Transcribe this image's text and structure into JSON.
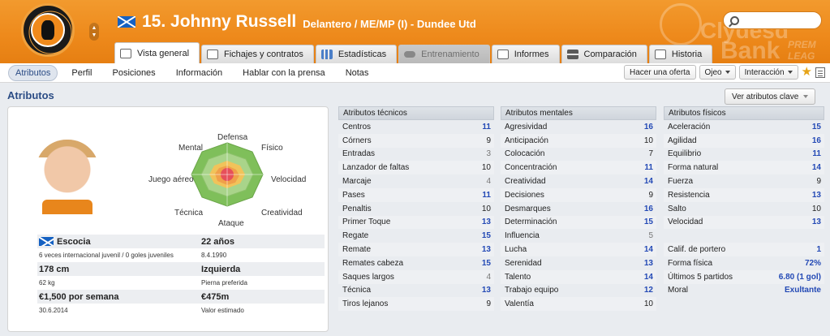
{
  "header": {
    "player_name": "15. Johnny Russell",
    "subtitle": "Delantero / ME/MP (I) - Dundee Utd",
    "flag_icon": "scotland-flag-icon",
    "stepper_up": "▲",
    "stepper_down": "▼",
    "sponsor": {
      "line1": "Clydesd",
      "line2": "Bank",
      "line3": "PREM LEAG"
    },
    "search_placeholder": ""
  },
  "tabs": [
    {
      "label": "Vista general",
      "icon": "overview-icon",
      "state": "active"
    },
    {
      "label": "Fichajes y contratos",
      "icon": "document-icon",
      "state": "normal"
    },
    {
      "label": "Estadísticas",
      "icon": "bar-chart-icon",
      "state": "normal"
    },
    {
      "label": "Entrenamiento",
      "icon": "cloud-icon",
      "state": "disabled"
    },
    {
      "label": "Informes",
      "icon": "report-icon",
      "state": "normal"
    },
    {
      "label": "Comparación",
      "icon": "compare-icon",
      "state": "normal"
    },
    {
      "label": "Historia",
      "icon": "history-icon",
      "state": "normal"
    }
  ],
  "subnav": {
    "items": [
      "Atributos",
      "Perfil",
      "Posiciones",
      "Información",
      "Hablar con la prensa",
      "Notas"
    ],
    "active": "Atributos",
    "actions": {
      "offer": "Hacer una oferta",
      "eye": "Ojeo",
      "interaction": "Interacción"
    }
  },
  "section": {
    "title": "Atributos",
    "key_button": "Ver atributos clave"
  },
  "radar": {
    "labels": {
      "top": "Defensa",
      "top_left": "Mental",
      "top_right": "Físico",
      "left": "Juego aéreo",
      "right": "Velocidad",
      "bottom_left": "Técnica",
      "bottom_right": "Creatividad",
      "bottom": "Ataque"
    }
  },
  "info": {
    "nation": "Escocia",
    "age": "22 años",
    "caps": "6 veces internacional juvenil / 0 goles juveniles",
    "dob": "8.4.1990",
    "height": "178 cm",
    "foot": "Izquierda",
    "weight": "62 kg",
    "foot_label": "Pierna preferida",
    "wage": "€1,500 por semana",
    "value": "€475m",
    "contract": "30.6.2014",
    "value_label": "Valor estimado"
  },
  "technical": {
    "title": "Atributos técnicos",
    "rows": [
      {
        "name": "Centros",
        "value": "11",
        "tone": "blue"
      },
      {
        "name": "Córners",
        "value": "9",
        "tone": "black"
      },
      {
        "name": "Entradas",
        "value": "3",
        "tone": "gray"
      },
      {
        "name": "Lanzador de faltas",
        "value": "10",
        "tone": "black"
      },
      {
        "name": "Marcaje",
        "value": "4",
        "tone": "gray"
      },
      {
        "name": "Pases",
        "value": "11",
        "tone": "blue"
      },
      {
        "name": "Penaltis",
        "value": "10",
        "tone": "black"
      },
      {
        "name": "Primer Toque",
        "value": "13",
        "tone": "blue"
      },
      {
        "name": "Regate",
        "value": "15",
        "tone": "blue"
      },
      {
        "name": "Remate",
        "value": "13",
        "tone": "blue"
      },
      {
        "name": "Remates cabeza",
        "value": "15",
        "tone": "blue"
      },
      {
        "name": "Saques largos",
        "value": "4",
        "tone": "gray"
      },
      {
        "name": "Técnica",
        "value": "13",
        "tone": "blue"
      },
      {
        "name": "Tiros lejanos",
        "value": "9",
        "tone": "black"
      }
    ]
  },
  "mental": {
    "title": "Atributos mentales",
    "rows": [
      {
        "name": "Agresividad",
        "value": "16",
        "tone": "blue"
      },
      {
        "name": "Anticipación",
        "value": "10",
        "tone": "black"
      },
      {
        "name": "Colocación",
        "value": "7",
        "tone": "black"
      },
      {
        "name": "Concentración",
        "value": "11",
        "tone": "blue"
      },
      {
        "name": "Creatividad",
        "value": "14",
        "tone": "blue"
      },
      {
        "name": "Decisiones",
        "value": "9",
        "tone": "black"
      },
      {
        "name": "Desmarques",
        "value": "16",
        "tone": "blue"
      },
      {
        "name": "Determinación",
        "value": "15",
        "tone": "blue"
      },
      {
        "name": "Influencia",
        "value": "5",
        "tone": "gray"
      },
      {
        "name": "Lucha",
        "value": "14",
        "tone": "blue"
      },
      {
        "name": "Serenidad",
        "value": "13",
        "tone": "blue"
      },
      {
        "name": "Talento",
        "value": "14",
        "tone": "blue"
      },
      {
        "name": "Trabajo equipo",
        "value": "12",
        "tone": "blue"
      },
      {
        "name": "Valentía",
        "value": "10",
        "tone": "black"
      }
    ]
  },
  "physical": {
    "title": "Atributos físicos",
    "rows": [
      {
        "name": "Aceleración",
        "value": "15",
        "tone": "blue"
      },
      {
        "name": "Agilidad",
        "value": "16",
        "tone": "blue"
      },
      {
        "name": "Equilibrio",
        "value": "11",
        "tone": "blue"
      },
      {
        "name": "Forma natural",
        "value": "14",
        "tone": "blue"
      },
      {
        "name": "Fuerza",
        "value": "9",
        "tone": "black"
      },
      {
        "name": "Resistencia",
        "value": "13",
        "tone": "blue"
      },
      {
        "name": "Salto",
        "value": "10",
        "tone": "black"
      },
      {
        "name": "Velocidad",
        "value": "13",
        "tone": "blue"
      }
    ],
    "extra": [
      {
        "name": "Calif. de portero",
        "value": "1",
        "tone": "blue"
      },
      {
        "name": "Forma física",
        "value": "72%",
        "tone": "blue"
      },
      {
        "name": "Últimos 5 partidos",
        "value": "6.80 (1 gol)",
        "tone": "blue"
      },
      {
        "name": "Moral",
        "value": "Exultante",
        "tone": "blue"
      }
    ]
  },
  "colors": {
    "accent": "#2349b5",
    "header": "#ee8a1c",
    "radar_green": "#7fbf5a"
  }
}
